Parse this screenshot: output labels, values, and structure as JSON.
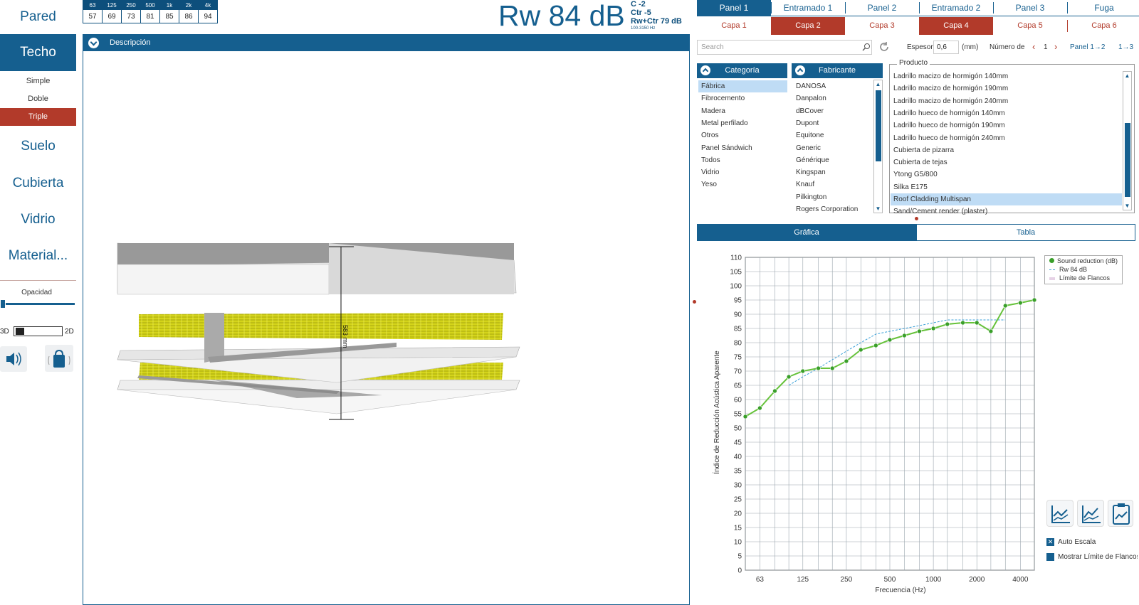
{
  "sidebar": {
    "items": [
      "Pared",
      "Techo",
      "Suelo",
      "Cubierta",
      "Vidrio",
      "Material..."
    ],
    "sub_items": [
      "Simple",
      "Doble",
      "Triple"
    ],
    "opacity_label": "Opacidad",
    "toggle_3d": "3D",
    "toggle_2d": "2D"
  },
  "freq_table": {
    "headers": [
      "63",
      "125",
      "250",
      "500",
      "1k",
      "2k",
      "4k"
    ],
    "values": [
      "57",
      "69",
      "73",
      "81",
      "85",
      "86",
      "94"
    ]
  },
  "rating": {
    "rw": "Rw 84 dB",
    "c": "C -2",
    "ctr": "Ctr -5",
    "rw_ctr": "Rw+Ctr 79 dB",
    "range": "100-3150 Hz"
  },
  "view": {
    "header": "Descripción",
    "dimension": "583 mm"
  },
  "panel_tabs": [
    "Panel 1",
    "Entramado 1",
    "Panel 2",
    "Entramado 2",
    "Panel 3",
    "Fuga"
  ],
  "layer_tabs": [
    "Capa 1",
    "Capa 2",
    "Capa 3",
    "Capa 4",
    "Capa 5",
    "Capa 6"
  ],
  "controls": {
    "search_placeholder": "Search",
    "espesor_label": "Espesor",
    "espesor_value": "0,6",
    "unit": "(mm)",
    "numero_label": "Número de",
    "numero_value": "1",
    "panel_link": "Panel 1→2",
    "range_link": "1→3"
  },
  "categoria": {
    "header": "Categoría",
    "items": [
      "Fábrica",
      "Fibrocemento",
      "Madera",
      "Metal perfilado",
      "Otros",
      "Panel Sándwich",
      "Todos",
      "Vidrio",
      "Yeso"
    ]
  },
  "fabricante": {
    "header": "Fabricante",
    "items": [
      "DANOSA",
      "Danpalon",
      "dBCover",
      "Dupont",
      "Equitone",
      "Generic",
      "Générique",
      "Kingspan",
      "Knauf",
      "Pilkington",
      "Rogers Corporation"
    ]
  },
  "producto": {
    "header": "Producto",
    "items": [
      "Ladrillo macizo de hormigón 140mm",
      "Ladrillo macizo de hormigón 190mm",
      "Ladrillo macizo de hormigón 240mm",
      "Ladrillo hueco de hormigón 140mm",
      "Ladrillo hueco de hormigón 190mm",
      "Ladrillo hueco de hormigón 240mm",
      "Cubierta de pizarra",
      "Cubierta de tejas",
      "Ytong G5/800",
      "Silka E175",
      "Roof Cladding Multispan",
      "Sand/Cement render (plaster)"
    ]
  },
  "chart_tabs": [
    "Gráfica",
    "Tabla"
  ],
  "options": {
    "auto_scale": "Auto Escala",
    "show_limit": "Mostrar Límite de Flancos"
  },
  "colors": {
    "primary": "#155f8f",
    "accent": "#b23a2a",
    "series": "#66c23a",
    "ref": "#3aa0d8"
  },
  "chart_data": {
    "type": "line",
    "xlabel": "Frecuencia (Hz)",
    "ylabel": "Índice de Reducción Acústica Aparente",
    "x_scale": "log",
    "xlim": [
      50,
      5000
    ],
    "ylim": [
      0,
      110
    ],
    "x_ticks": [
      63,
      125,
      250,
      500,
      1000,
      2000,
      4000
    ],
    "y_ticks": [
      0,
      5,
      10,
      15,
      20,
      25,
      30,
      35,
      40,
      45,
      50,
      55,
      60,
      65,
      70,
      75,
      80,
      85,
      90,
      95,
      100,
      105,
      110
    ],
    "grid": true,
    "legend_position": "top-right",
    "series": [
      {
        "name": "Sound reduction (dB)",
        "x": [
          50,
          63,
          80,
          100,
          125,
          160,
          200,
          250,
          315,
          400,
          500,
          630,
          800,
          1000,
          1250,
          1600,
          2000,
          2500,
          3150,
          4000,
          5000
        ],
        "y": [
          54,
          57,
          63,
          68,
          70,
          71,
          71,
          73.5,
          77.5,
          79,
          81,
          82.5,
          84,
          85,
          86.5,
          87,
          87,
          84,
          93,
          94,
          95
        ]
      },
      {
        "name": "Rw 84 dB",
        "x": [
          100,
          125,
          160,
          200,
          250,
          315,
          400,
          500,
          630,
          800,
          1000,
          1250,
          1600,
          2000,
          2500,
          3150
        ],
        "y": [
          65,
          68,
          71,
          74,
          77,
          80,
          83,
          84,
          85,
          86,
          87,
          88,
          88,
          88,
          88,
          88
        ]
      },
      {
        "name": "Límite de Flancos",
        "x": [],
        "y": []
      }
    ]
  }
}
